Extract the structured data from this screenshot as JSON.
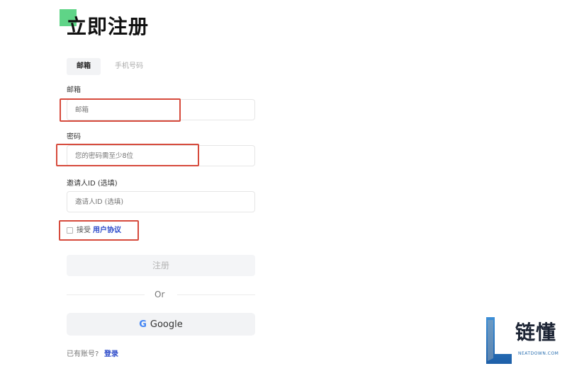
{
  "title": "立即注册",
  "tabs": [
    {
      "label": "邮箱",
      "active": true
    },
    {
      "label": "手机号码",
      "active": false
    }
  ],
  "fields": {
    "email": {
      "label": "邮箱",
      "placeholder": "邮箱"
    },
    "password": {
      "label": "密码",
      "placeholder": "您的密码需至少8位"
    },
    "referrer": {
      "label": "邀请人ID (选填)",
      "placeholder": "邀请人ID (选填)"
    }
  },
  "agreement": {
    "accept_text": "接受",
    "link_text": "用户协议"
  },
  "buttons": {
    "register": "注册",
    "google": "Google"
  },
  "divider_text": "Or",
  "footer": {
    "have_account": "已有账号?",
    "login": "登录"
  },
  "watermark": {
    "text": "链懂",
    "sub": "NEATDOWN.COM"
  },
  "colors": {
    "accent": "#5fd487",
    "link": "#2b49c9",
    "highlight": "#d64a3c"
  }
}
